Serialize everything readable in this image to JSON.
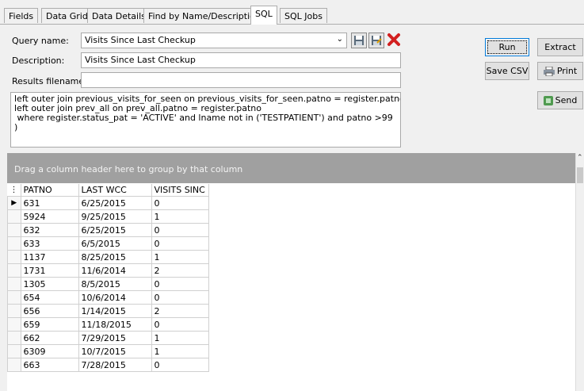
{
  "tabs": [
    {
      "label": "Fields"
    },
    {
      "label": "Data Grid"
    },
    {
      "label": "Data Details"
    },
    {
      "label": "Find by Name/Description"
    },
    {
      "label": "SQL"
    },
    {
      "label": "SQL Jobs"
    }
  ],
  "form": {
    "query_name_label": "Query name:",
    "query_name_value": "Visits Since Last Checkup",
    "description_label": "Description:",
    "description_value": "Visits Since Last Checkup",
    "results_filename_label": "Results filename:",
    "results_filename_value": ""
  },
  "buttons": {
    "run": "Run",
    "extract": "Extract",
    "save_csv": "Save CSV",
    "print": "Print",
    "send": "Send"
  },
  "sql_text": "left outer join previous_visits_for_seen on previous_visits_for_seen.patno = register.patno\nleft outer join prev_all on prev_all.patno = register.patno\n where register.status_pat = 'ACTIVE' and lname not in ('TESTPATIENT') and patno >99\n)",
  "grid": {
    "group_hint": "Drag a column header here to group by that column",
    "columns": [
      "PATNO",
      "LAST WCC",
      "VISITS SINC"
    ],
    "rows": [
      [
        "631",
        "6/25/2015",
        "0"
      ],
      [
        "5924",
        "9/25/2015",
        "1"
      ],
      [
        "632",
        "6/25/2015",
        "0"
      ],
      [
        "633",
        "6/5/2015",
        "0"
      ],
      [
        "1137",
        "8/25/2015",
        "1"
      ],
      [
        "1731",
        "11/6/2014",
        "2"
      ],
      [
        "1305",
        "8/5/2015",
        "0"
      ],
      [
        "654",
        "10/6/2014",
        "0"
      ],
      [
        "656",
        "1/14/2015",
        "2"
      ],
      [
        "659",
        "11/18/2015",
        "0"
      ],
      [
        "662",
        "7/29/2015",
        "1"
      ],
      [
        "6309",
        "10/7/2015",
        "1"
      ],
      [
        "663",
        "7/28/2015",
        "0"
      ]
    ]
  },
  "icons": {
    "open": "folder-open-icon",
    "save": "save-icon",
    "save_as": "save-as-icon",
    "delete": "delete-x-icon",
    "print": "printer-icon",
    "send": "send-icon"
  },
  "colors": {
    "accent": "#0078d7",
    "delete_red": "#d21f1f",
    "group_panel": "#a0a0a0"
  }
}
